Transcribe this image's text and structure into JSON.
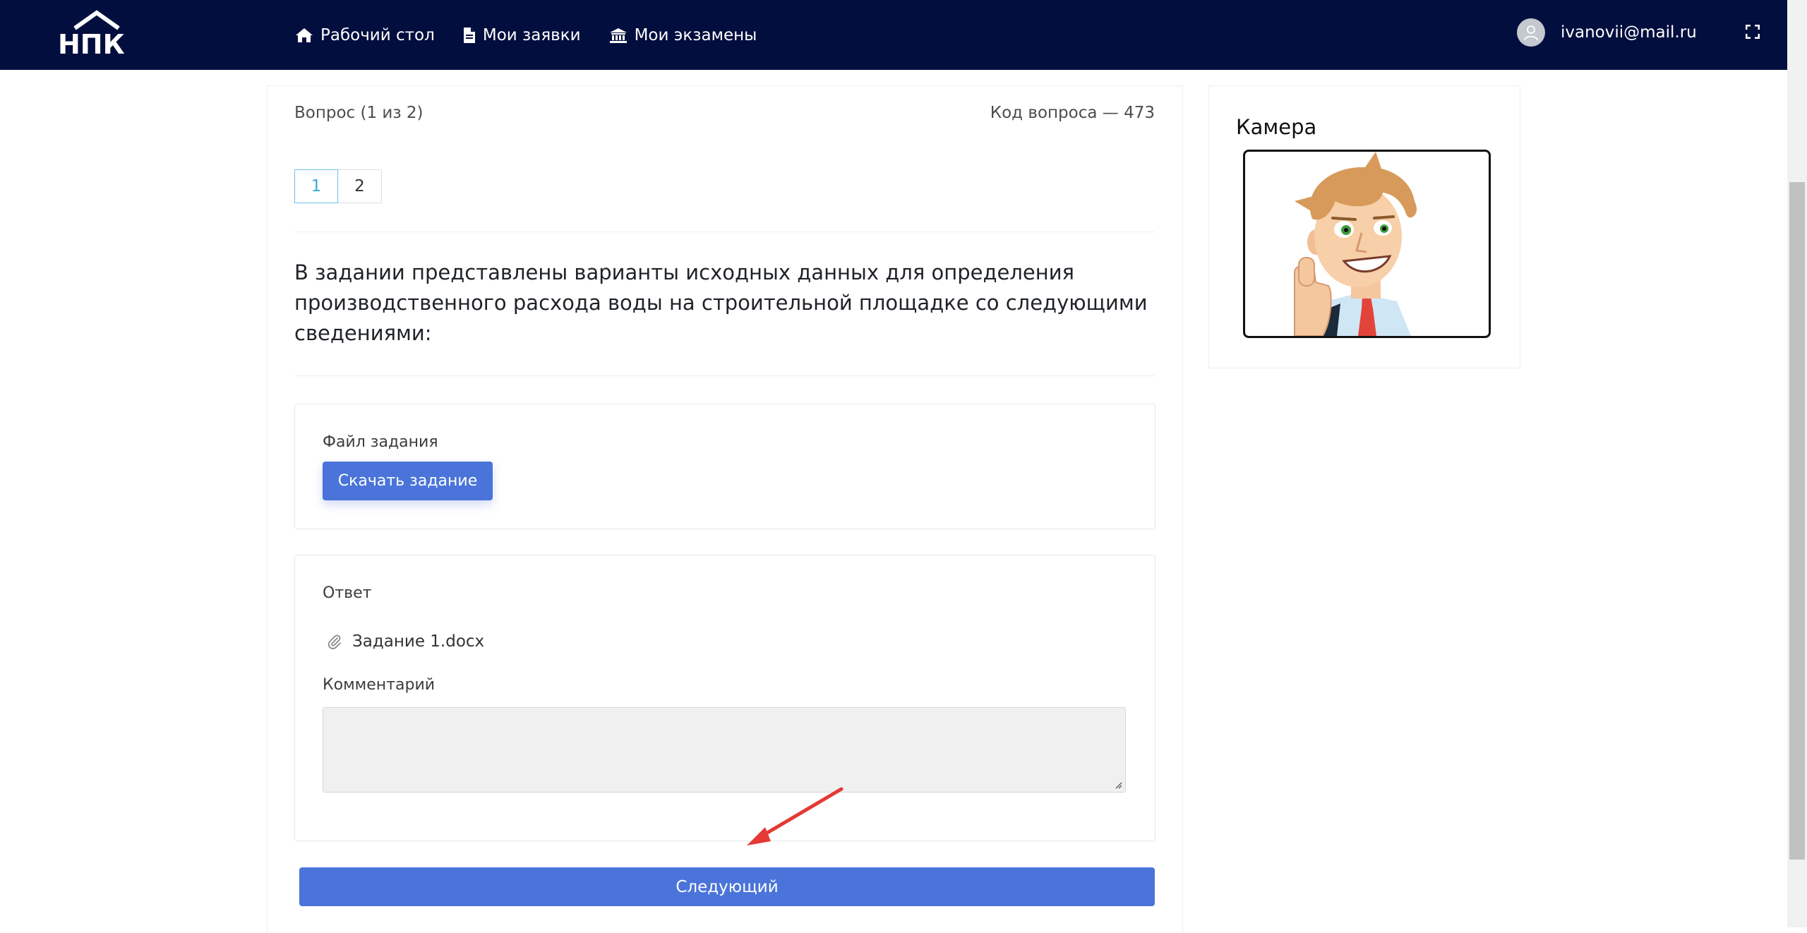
{
  "header": {
    "logo_text": "НПК",
    "nav": [
      {
        "label": "Рабочий стол",
        "icon": "home-icon"
      },
      {
        "label": "Мои заявки",
        "icon": "document-icon"
      },
      {
        "label": "Мои экзамены",
        "icon": "institution-icon"
      }
    ],
    "user_email": "ivanovii@mail.ru"
  },
  "question": {
    "counter": "Вопрос (1 из 2)",
    "code": "Код вопроса — 473",
    "pages": [
      "1",
      "2"
    ],
    "active_page": "1",
    "text": "В задании представлены варианты исходных данных для определения производственного расхода воды на строительной площадке со следующими сведениями:"
  },
  "task_file": {
    "label": "Файл задания",
    "download_button": "Скачать задание"
  },
  "answer": {
    "label": "Ответ",
    "attached_file": "Задание 1.docx",
    "comment_label": "Комментарий",
    "comment_value": ""
  },
  "next_button": "Следующий",
  "camera": {
    "title": "Камера"
  },
  "colors": {
    "header_bg": "#020e3e",
    "primary": "#4a74d9",
    "active_page": "#3ba7d8",
    "arrow": "#e53935"
  }
}
